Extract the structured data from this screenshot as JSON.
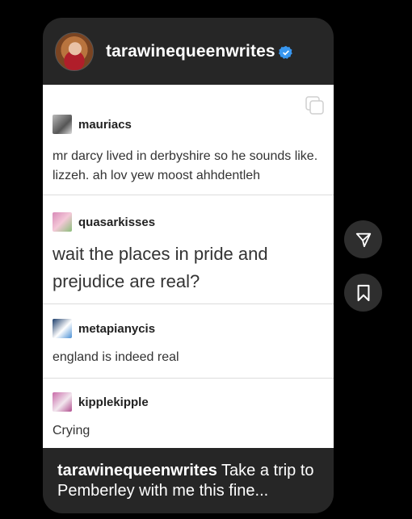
{
  "post": {
    "username": "tarawinequeenwrites",
    "verified_icon": "verified-badge-icon",
    "caption_username": "tarawinequeenwrites",
    "caption_text": " Take a trip to Pemberley with me this fine..."
  },
  "reblogs": [
    {
      "user": "mauriacs",
      "line1": "mr darcy lived in derbyshire so he sounds like.",
      "line2": "lizzeh. ah lov yew moost ahhdentleh"
    },
    {
      "user": "quasarkisses",
      "line1": "wait the places in pride and",
      "line2": "prejudice are real?"
    },
    {
      "user": "metapianycis",
      "line1": "england is indeed real"
    },
    {
      "user": "kipplekipple",
      "line1": "Crying"
    }
  ],
  "actions": {
    "share_icon": "share-icon",
    "save_icon": "bookmark-icon"
  },
  "colors": {
    "background": "#000000",
    "card": "#262626",
    "verified": "#3897f0"
  }
}
